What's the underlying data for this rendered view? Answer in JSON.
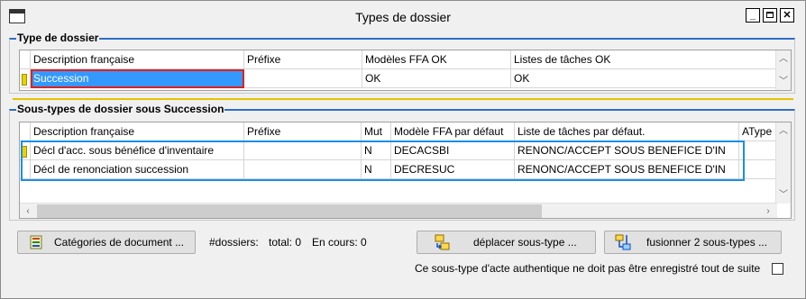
{
  "window": {
    "title": "Types de dossier"
  },
  "type_group": {
    "label": "Type de dossier",
    "columns": [
      "Description française",
      "Préfixe",
      "Modèles FFA OK",
      "Listes de tâches OK"
    ],
    "rows": [
      {
        "description": "Succession",
        "prefix": "",
        "modeles": "OK",
        "listes": "OK"
      }
    ]
  },
  "subtype_group": {
    "label": "Sous-types de dossier sous Succession",
    "columns": [
      "Description française",
      "Préfixe",
      "Mut",
      "Modèle FFA par défaut",
      "Liste de tâches par défaut.",
      "AType"
    ],
    "rows": [
      {
        "description": "Décl d'acc. sous bénéfice d'inventaire",
        "prefix": "",
        "mut": "N",
        "modele": "DECACSBI",
        "liste": "RENONC/ACCEPT SOUS BENEFICE D'IN",
        "atype": ""
      },
      {
        "description": "Décl de renonciation succession",
        "prefix": "",
        "mut": "N",
        "modele": "DECRESUC",
        "liste": "RENONC/ACCEPT SOUS BENEFICE D'IN",
        "atype": ""
      }
    ]
  },
  "footer": {
    "categories_button": "Catégories de document ...",
    "dossiers_label": "#dossiers:",
    "total": "total: 0",
    "en_cours": "En cours: 0",
    "move_button": "déplacer sous-type ...",
    "merge_button": "fusionner 2 sous-types ...",
    "checkbox_label": "Ce sous-type d'acte authentique ne doit pas être enregistré tout de suite",
    "checkbox_checked": false
  },
  "colors": {
    "selection": "#3399ff",
    "red_highlight": "#e02020",
    "blue_highlight": "#1c8ee6",
    "gold_separator": "#e6c200"
  },
  "icons": [
    "app-window-icon",
    "minimize-icon",
    "maximize-icon",
    "close-icon",
    "categories-icon",
    "move-subtype-icon",
    "merge-subtypes-icon",
    "scroll-up-icon",
    "scroll-down-icon",
    "scroll-left-icon",
    "scroll-right-icon"
  ]
}
